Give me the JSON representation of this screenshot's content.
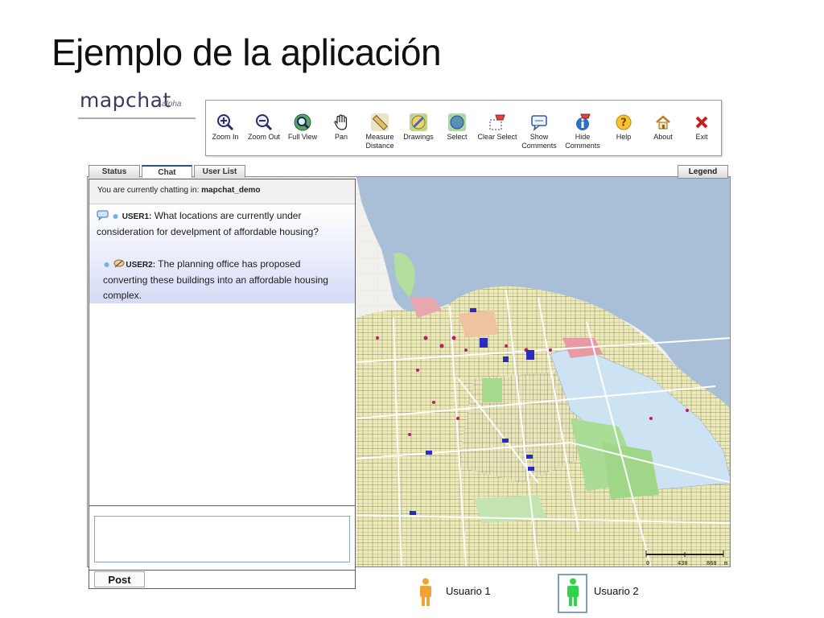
{
  "slide": {
    "title": "Ejemplo de la aplicación"
  },
  "logo": {
    "name": "mapchat",
    "suffix": "alpha"
  },
  "toolbar": {
    "items": [
      {
        "label": "Zoom In",
        "icon": "zoom-in-icon"
      },
      {
        "label": "Zoom Out",
        "icon": "zoom-out-icon"
      },
      {
        "label": "Full View",
        "icon": "full-view-icon"
      },
      {
        "label": "Pan",
        "icon": "hand-icon"
      },
      {
        "label": "Measure Distance",
        "icon": "ruler-icon"
      },
      {
        "label": "Drawings",
        "icon": "pencil-icon"
      },
      {
        "label": "Select",
        "icon": "globe-select-icon"
      },
      {
        "label": "Clear Select",
        "icon": "clear-select-icon"
      },
      {
        "label": "Show Comments",
        "icon": "speech-bubble-icon"
      },
      {
        "label": "Hide Comments",
        "icon": "hide-comments-icon"
      },
      {
        "label": "Help",
        "icon": "question-icon"
      },
      {
        "label": "About",
        "icon": "home-icon"
      },
      {
        "label": "Exit",
        "icon": "close-x-icon"
      }
    ]
  },
  "tabs": [
    {
      "label": "Status",
      "active": false
    },
    {
      "label": "Chat",
      "active": true
    },
    {
      "label": "User List",
      "active": false
    }
  ],
  "legend_label": "Legend",
  "chat": {
    "header_prefix": "You are currently chatting in:",
    "room": "mapchat_demo",
    "messages": [
      {
        "user": "USER1:",
        "text": " What locations are currently under consideration for develpment of affordable housing?"
      },
      {
        "user": "USER2:",
        "text": " The planning office has proposed converting these buildings into an affordable housing complex."
      }
    ],
    "input_value": "",
    "post_label": "Post"
  },
  "scalebar": {
    "labels": [
      "0",
      "430",
      "860"
    ],
    "unit": "m"
  },
  "users_legend": [
    {
      "label": "Usuario 1",
      "color": "#f1a237"
    },
    {
      "label": "Usuario 2",
      "color": "#2fd44a"
    }
  ],
  "colors": {
    "water": "#a8bcd4",
    "residential": "#efedb7",
    "commercial": "#e79aa3",
    "institutional": "#cfe6f6",
    "park": "#aee0a0",
    "industrial": "#d7cbe6"
  }
}
